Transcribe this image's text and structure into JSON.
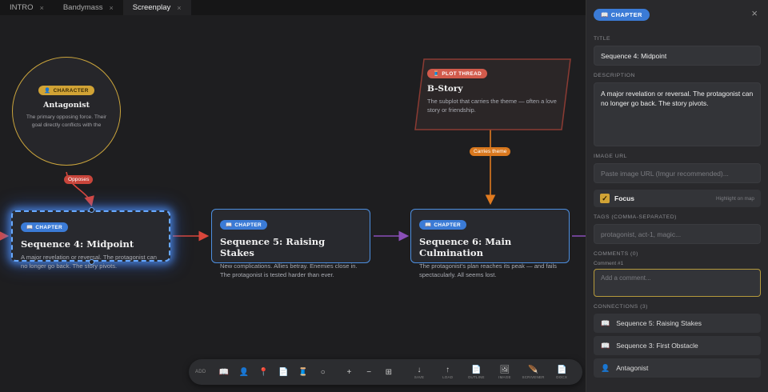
{
  "tabs": [
    {
      "label": "INTRO",
      "close": "×"
    },
    {
      "label": "Bandymass",
      "close": "×"
    },
    {
      "label": "Screenplay",
      "close": "×"
    }
  ],
  "nodes": {
    "antagonist": {
      "badge": "CHARACTER",
      "icon": "👤",
      "title": "Antagonist",
      "desc": "The primary opposing force. Their goal directly conflicts with the"
    },
    "bstory": {
      "badge": "PLOT THREAD",
      "icon": "🧵",
      "title": "B-Story",
      "desc": "The subplot that carries the theme — often a love story or friendship."
    },
    "seq4": {
      "badge": "CHAPTER",
      "icon": "📖",
      "title": "Sequence 4: Midpoint",
      "desc": "A major revelation or reversal. The protagonist can no longer go back. The story pivots."
    },
    "seq5": {
      "badge": "CHAPTER",
      "icon": "📖",
      "title": "Sequence 5: Raising Stakes",
      "desc": "New complications. Allies betray. Enemies close in. The protagonist is tested harder than ever."
    },
    "seq6": {
      "badge": "CHAPTER",
      "icon": "📖",
      "title": "Sequence 6: Main Culmination",
      "desc": "The protagonist's plan reaches its peak — and fails spectacularly. All seems lost."
    }
  },
  "edge_labels": {
    "opposes": "Opposes",
    "carries_theme": "Carries theme"
  },
  "colors": {
    "chapter": "#4d8fe0",
    "character": "#caa43c",
    "plot": "#8b3b33",
    "opposes": "#d9463b",
    "theme": "#e07a1f",
    "flow": "#8a4fb7"
  },
  "toolbar": {
    "add_label": "ADD",
    "buttons": [
      {
        "name": "add-chapter-button",
        "icon": "📖",
        "label": ""
      },
      {
        "name": "add-character-button",
        "icon": "👤",
        "label": ""
      },
      {
        "name": "add-location-button",
        "icon": "📍",
        "label": ""
      },
      {
        "name": "add-note-button",
        "icon": "📄",
        "label": ""
      },
      {
        "name": "add-plot-thread-button",
        "icon": "🧵",
        "label": ""
      },
      {
        "name": "add-circle-button",
        "icon": "○",
        "label": ""
      }
    ],
    "zoom_in": "+",
    "zoom_out": "−",
    "fit": "⊞",
    "save_icon": "↓",
    "save_label": "SAVE",
    "load_icon": "↑",
    "load_label": "LOAD",
    "outline_icon": "📄",
    "outline_label": "OUTLINE",
    "image_icon": "🖼",
    "image_label": "IMAGE",
    "scrivener_icon": "🪶",
    "scrivener_label": "SCRIVENER",
    "docx_icon": "📄",
    "docx_label": "DOCX"
  },
  "panel": {
    "badge": "CHAPTER",
    "badge_icon": "📖",
    "close": "×",
    "title_label": "TITLE",
    "title_value": "Sequence 4: Midpoint",
    "description_label": "DESCRIPTION",
    "description_value": "A major revelation or reversal. The protagonist can no longer go back. The story pivots.",
    "image_url_label": "IMAGE URL",
    "image_url_placeholder": "Paste image URL (Imgur recommended)...",
    "focus_label": "Focus",
    "focus_hint": "Highlight on map",
    "focus_checked": true,
    "tags_label": "TAGS (COMMA-SEPARATED)",
    "tags_placeholder": "protagonist, act-1, magic...",
    "comments_label": "COMMENTS (0)",
    "comment_sub": "Comment #1",
    "comment_placeholder": "Add a comment...",
    "connections_label": "CONNECTIONS (3)",
    "connections": [
      {
        "icon": "📖",
        "label": "Sequence 5: Raising Stakes"
      },
      {
        "icon": "📖",
        "label": "Sequence 3: First Obstacle"
      },
      {
        "icon": "👤",
        "label": "Antagonist"
      }
    ]
  }
}
